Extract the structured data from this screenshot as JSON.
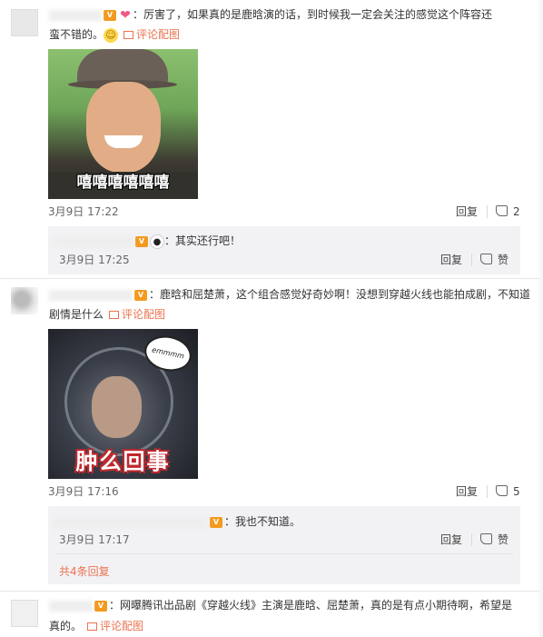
{
  "comments": [
    {
      "text_line1": "：厉害了，如果真的是鹿晗演的话，到时候我一定会关注的感觉这个阵容还",
      "text_line2": "蛮不错的。",
      "pic_link": "评论配图",
      "meme_caption": "嘻嘻嘻嘻嘻嘻",
      "time": "3月9日 17:22",
      "reply_label": "回复",
      "like_count": "2",
      "sub_replies": [
        {
          "text": "：其实还行吧！",
          "time": "3月9日 17:25",
          "reply_label": "回复",
          "like_label": "赞"
        }
      ]
    },
    {
      "text_line1": "：鹿晗和屈楚萧，这个组合感觉好奇妙啊！没想到穿越火线也能拍成剧，不知道",
      "text_line2": "剧情是什么",
      "pic_link": "评论配图",
      "meme_bubble": "emmmm",
      "meme_caption": "肿么回事",
      "time": "3月9日 17:16",
      "reply_label": "回复",
      "like_count": "5",
      "sub_replies": [
        {
          "text": "：我也不知道。",
          "time": "3月9日 17:17",
          "reply_label": "回复",
          "like_label": "赞"
        }
      ],
      "more_replies": "共4条回复"
    },
    {
      "text_line1": "：网曝腾讯出品剧《穿越火线》主演是鹿晗、屈楚萧，真的是有点小期待啊，希望是",
      "text_line2": "真的。",
      "pic_link": "评论配图"
    }
  ],
  "icons": {
    "vip": "vip-badge-icon",
    "like": "thumb-up-icon",
    "pic": "image-icon"
  },
  "colors": {
    "link": "#eb7350",
    "reply_bg": "#f2f2f5",
    "vip": "#f39a1e"
  }
}
